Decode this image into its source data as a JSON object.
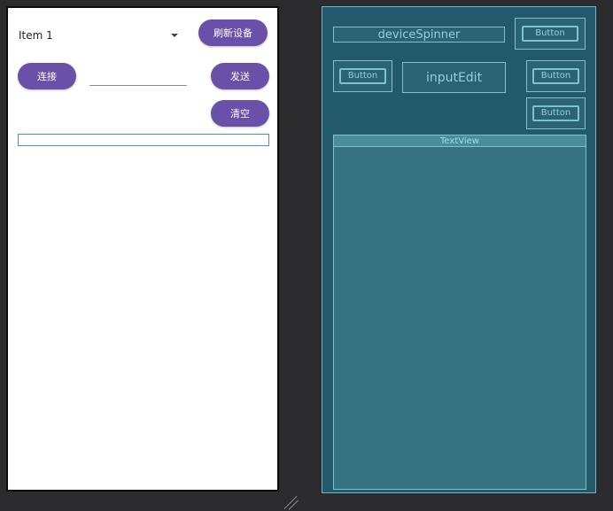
{
  "design": {
    "spinner_value": "Item 1",
    "refresh_button": "刷新设备",
    "connect_button": "连接",
    "send_button": "发送",
    "clear_button": "清空"
  },
  "blueprint": {
    "spinner_label": "deviceSpinner",
    "edit_label": "inputEdit",
    "button_label": "Button",
    "textview_label": "TextView"
  },
  "colors": {
    "accent": "#6a50a8",
    "blueprint_bg": "#225a6b",
    "blueprint_line": "#7dc2cf"
  }
}
